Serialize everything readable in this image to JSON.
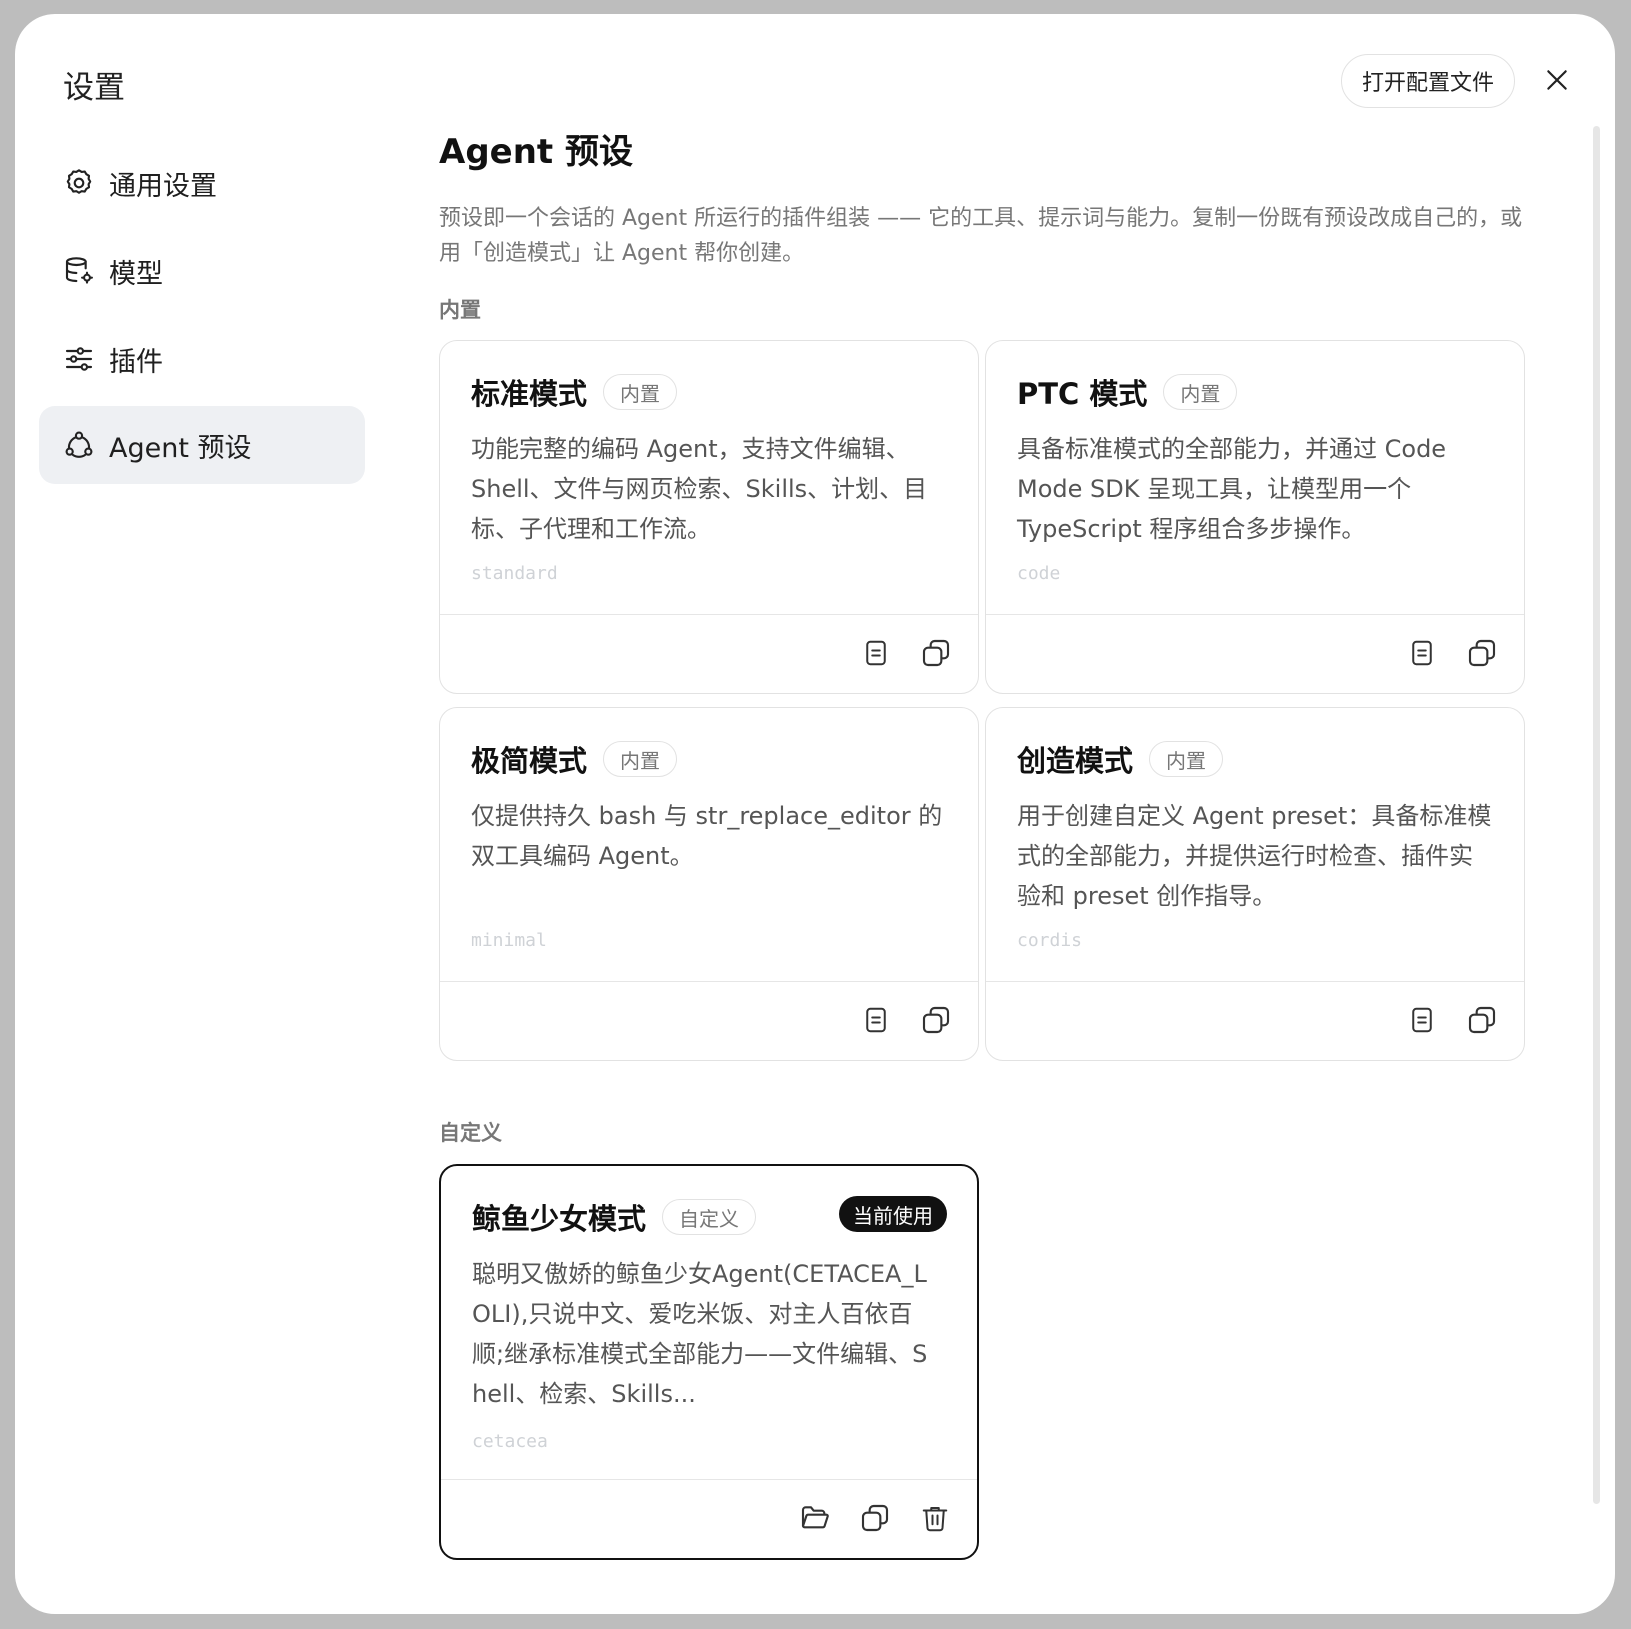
{
  "dialog": {
    "title": "设置",
    "open_config_label": "打开配置文件",
    "close_icon": "close-icon"
  },
  "sidebar": {
    "items": [
      {
        "label": "通用设置",
        "icon": "gear-icon",
        "active": false
      },
      {
        "label": "模型",
        "icon": "database-settings-icon",
        "active": false
      },
      {
        "label": "插件",
        "icon": "sliders-icon",
        "active": false
      },
      {
        "label": "Agent 预设",
        "icon": "agent-network-icon",
        "active": true
      }
    ]
  },
  "main": {
    "title": "Agent 预设",
    "description": "预设即一个会话的 Agent 所运行的插件组装 —— 它的工具、提示词与能力。复制一份既有预设改成自己的，或用「创造模式」让 Agent 帮你创建。",
    "builtin_section_label": "内置",
    "custom_section_label": "自定义",
    "builtin_presets": [
      {
        "title": "标准模式",
        "badge": "内置",
        "description": "功能完整的编码 Agent，支持文件编辑、Shell、文件与网页检索、Skills、计划、目标、子代理和工作流。",
        "id": "standard"
      },
      {
        "title": "PTC 模式",
        "badge": "内置",
        "description": "具备标准模式的全部能力，并通过 Code Mode SDK 呈现工具，让模型用一个 TypeScript 程序组合多步操作。",
        "id": "code"
      },
      {
        "title": "极简模式",
        "badge": "内置",
        "description": "仅提供持久 bash 与 str_replace_editor 的双工具编码 Agent。",
        "id": "minimal"
      },
      {
        "title": "创造模式",
        "badge": "内置",
        "description": "用于创建自定义 Agent preset：具备标准模式的全部能力，并提供运行时检查、插件实验和 preset 创作指导。",
        "id": "cordis"
      }
    ],
    "custom_presets": [
      {
        "title": "鲸鱼少女模式",
        "badge": "自定义",
        "current_label": "当前使用",
        "description": "聪明又傲娇的鲸鱼少女Agent(CETACEA_LOLI),只说中文、爱吃米饭、对主人百依百顺;继承标准模式全部能力——文件编辑、Shell、检索、Skills...",
        "id": "cetacea"
      }
    ]
  }
}
